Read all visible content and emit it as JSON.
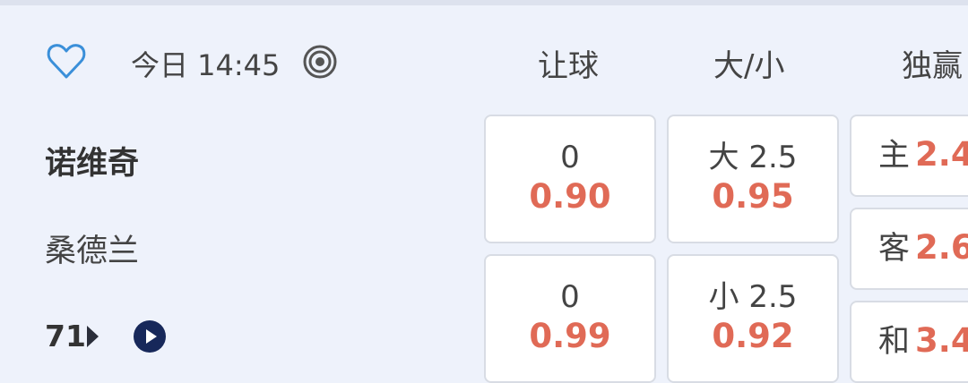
{
  "match": {
    "time": "今日 14:45",
    "home_team": "诺维奇",
    "away_team": "桑德兰",
    "more_count": "71"
  },
  "columns": {
    "handicap": "让球",
    "over_under": "大/小",
    "moneyline": "独赢"
  },
  "handicap": [
    {
      "line": "0",
      "odds": "0.90"
    },
    {
      "line": "0",
      "odds": "0.99"
    }
  ],
  "over_under": [
    {
      "line": "大 2.5",
      "odds": "0.95"
    },
    {
      "line": "小 2.5",
      "odds": "0.92"
    }
  ],
  "moneyline": [
    {
      "label": "主",
      "odds": "2.4"
    },
    {
      "label": "客",
      "odds": "2.6"
    },
    {
      "label": "和",
      "odds": "3.4"
    }
  ],
  "colors": {
    "odds": "#e06a56",
    "accent": "#3a8fd9",
    "play_button": "#17285a"
  },
  "icons": {
    "favorite": "heart-outline-icon",
    "target": "target-icon",
    "more_arrow": "caret-right-icon",
    "play": "play-circle-icon"
  }
}
